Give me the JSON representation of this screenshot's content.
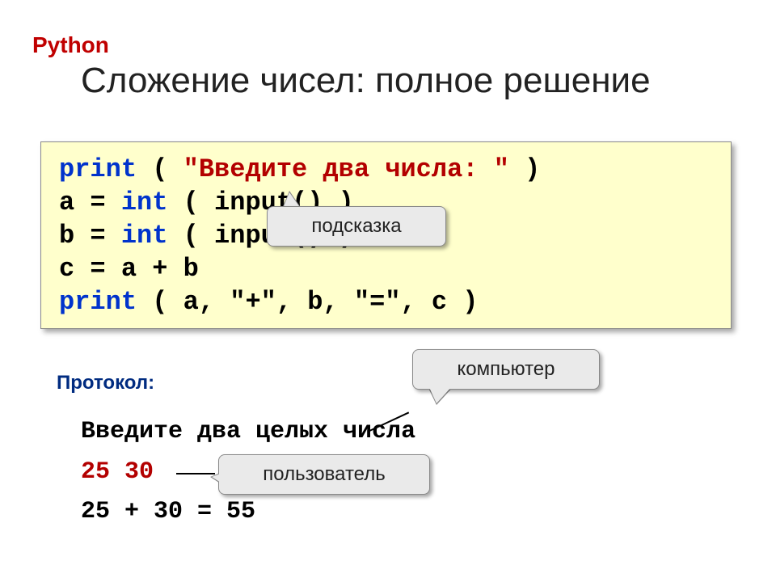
{
  "header": {
    "language": "Python",
    "title": "Сложение чисел: полное решение"
  },
  "code": {
    "line1_kw": "print",
    "line1_paren_open": " ( ",
    "line1_str": "\"Введите два числа: \"",
    "line1_paren_close": " )",
    "line2_pre": "a = ",
    "line2_kw": "int",
    "line2_post": " ( input() )",
    "line3_pre": "b = ",
    "line3_kw": "int",
    "line3_post": " ( input() )",
    "line4": "c = a + b",
    "line5_kw": "print",
    "line5_post": " ( a, \"+\", b, \"=\", c )"
  },
  "callouts": {
    "hint": "подсказка",
    "computer": "компьютер",
    "user": "пользователь"
  },
  "protocol": {
    "label": "Протокол:",
    "line1": "Введите два целых числа",
    "line2": "25 30",
    "line3": "25 + 30 = 55"
  }
}
